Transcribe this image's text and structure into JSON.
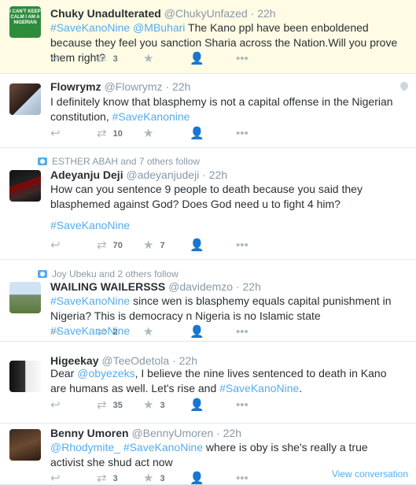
{
  "tweets": [
    {
      "name": "Chuky Unadulterated",
      "handle": "@ChukyUnfazed",
      "time": "22h",
      "avatar_text": "I CAN'T KEEP CALM I AM A NIGERIAN",
      "parts": [
        {
          "t": "#SaveKanoNine",
          "link": true
        },
        {
          "t": " ",
          "link": false
        },
        {
          "t": "@MBuhari",
          "link": true
        },
        {
          "t": " The Kano ppl have been enboldened because they feel you sanction Sharia across the Nation.Will you prove them right?",
          "link": false
        }
      ],
      "retweets": "3",
      "likes": ""
    },
    {
      "name": "Flowrymz",
      "handle": "@Flowrymz",
      "time": "22h",
      "parts": [
        {
          "t": "I definitely know that blasphemy is not a capital offense in the Nigerian constitution, ",
          "link": false
        },
        {
          "t": "#SaveKanonine",
          "link": true
        }
      ],
      "retweets": "10",
      "likes": ""
    },
    {
      "context": "ESTHER ABAH and 7 others follow",
      "name": "Adeyanju Deji",
      "handle": "@adeyanjudeji",
      "time": "22h",
      "parts": [
        {
          "t": "How can you sentence 9 people to death because you said they blasphemed against God? Does God need u to fight 4 him?",
          "link": false
        }
      ],
      "extra_line": "#SaveKanoNine",
      "retweets": "70",
      "likes": "7"
    },
    {
      "context": "Joy Ubeku and 2 others follow",
      "name": "WAILING WAILERSSS",
      "handle": "@davidemzo",
      "time": "22h",
      "parts": [
        {
          "t": "#SaveKanoNine",
          "link": true
        },
        {
          "t": " since wen is blasphemy equals capital punishment in Nigeria? This is democracy n Nigeria is no Islamic state ",
          "link": false
        },
        {
          "t": "#SaveKanoNine",
          "link": true
        }
      ],
      "retweets": "2",
      "likes": ""
    },
    {
      "name": "Higeekay",
      "handle": "@TeeOdetola",
      "time": "22h",
      "parts": [
        {
          "t": "Dear ",
          "link": false
        },
        {
          "t": "@obyezeks",
          "link": true
        },
        {
          "t": ", I believe the nine lives sentenced to death in Kano are humans as well. Let's rise and ",
          "link": false
        },
        {
          "t": "#SaveKanoNine",
          "link": true
        },
        {
          "t": ".",
          "link": false
        }
      ],
      "retweets": "35",
      "likes": "3"
    },
    {
      "name": "Benny Umoren",
      "handle": "@BennyUmoren",
      "time": "22h",
      "parts": [
        {
          "t": "@Rhodymite_",
          "link": true
        },
        {
          "t": " ",
          "link": false
        },
        {
          "t": "#SaveKanoNine",
          "link": true
        },
        {
          "t": " where is oby is she's really a true activist she shud act now",
          "link": false
        }
      ],
      "retweets": "3",
      "likes": "3"
    }
  ],
  "view_conversation": "View conversation",
  "icons": {
    "reply": "reply-icon",
    "retweet": "retweet-icon",
    "like": "star-icon",
    "follow": "follow-icon",
    "more": "more-icon"
  },
  "colors": {
    "link": "#55acee",
    "meta": "#8899a6",
    "highlight_bg": "#fffbe5"
  }
}
